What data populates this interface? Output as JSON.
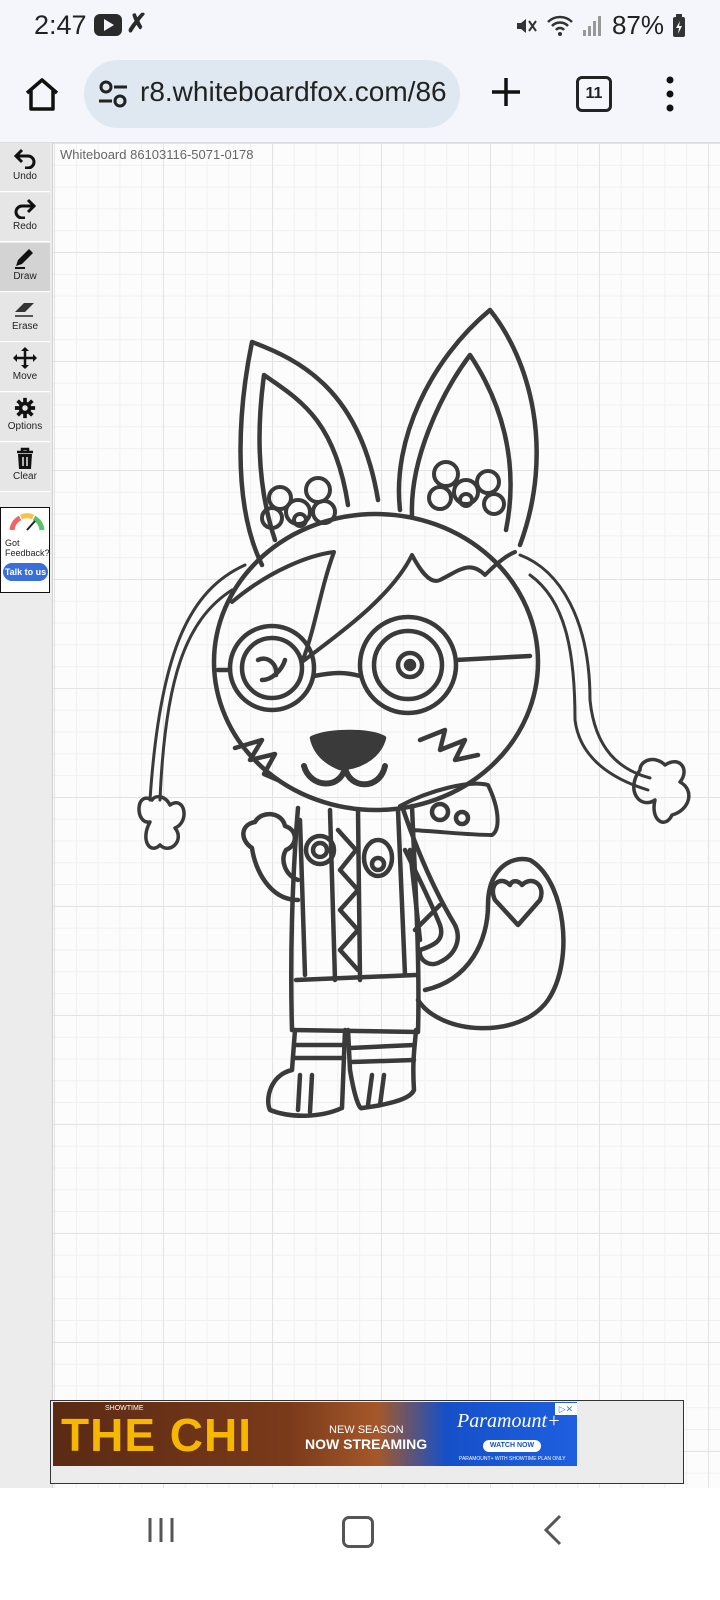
{
  "status_bar": {
    "time": "2:47",
    "battery": "87%",
    "icons": [
      "youtube-icon",
      "app-notification-icon",
      "mute-icon",
      "wifi-icon",
      "signal-icon",
      "battery-charging-icon"
    ]
  },
  "browser": {
    "url": "r8.whiteboardfox.com/86",
    "tab_count": "11",
    "icons": [
      "home-icon",
      "site-settings-icon",
      "new-tab-icon",
      "tabs-icon",
      "more-vert-icon"
    ]
  },
  "board": {
    "title": "Whiteboard 86103116-5071-0178"
  },
  "toolbar": {
    "tools": [
      {
        "label": "Undo",
        "icon": "undo-icon"
      },
      {
        "label": "Redo",
        "icon": "redo-icon"
      },
      {
        "label": "Draw",
        "icon": "pencil-icon",
        "active": true
      },
      {
        "label": "Erase",
        "icon": "eraser-icon"
      },
      {
        "label": "Move",
        "icon": "move-icon"
      },
      {
        "label": "Options",
        "icon": "gear-icon"
      },
      {
        "label": "Clear",
        "icon": "trash-icon"
      }
    ]
  },
  "feedback": {
    "text": "Got Feedback?",
    "button": "Talk to us"
  },
  "ad": {
    "network": "SHOWTIME",
    "show_title": "THE CHI",
    "line1": "NEW SEASON",
    "line2": "NOW STREAMING",
    "brand": "Paramount+",
    "cta": "WATCH NOW",
    "fine_print": "PARAMOUNT+ WITH SHOWTIME PLAN ONLY"
  },
  "colors": {
    "ink": "#3a3a3a",
    "toolbar_bg": "#ececec",
    "accent_blue": "#3b6fd8"
  }
}
